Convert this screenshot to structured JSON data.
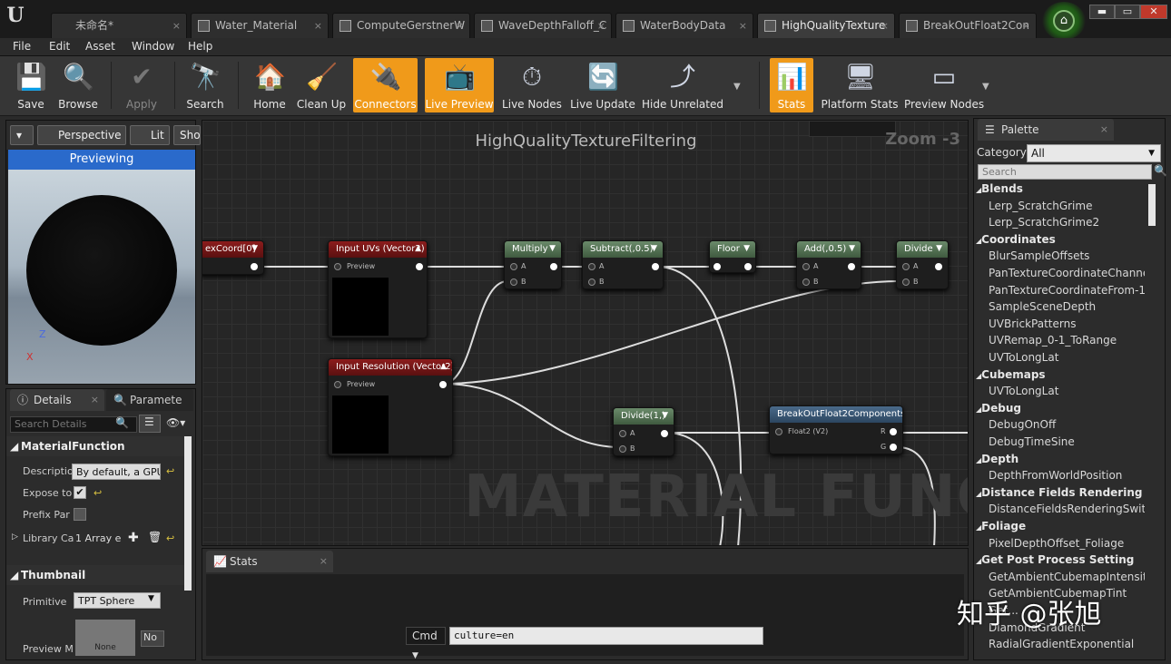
{
  "titlebar": {
    "tabs": [
      {
        "label": "未命名*"
      },
      {
        "label": "Water_Material"
      },
      {
        "label": "ComputeGerstnerW"
      },
      {
        "label": "WaveDepthFalloff_C"
      },
      {
        "label": "WaterBodyData"
      },
      {
        "label": "HighQualityTexture"
      },
      {
        "label": "BreakOutFloat2Con"
      }
    ],
    "close_glyph": "×",
    "window_buttons": {
      "minimize": "▬",
      "maximize": "▭",
      "close": "✕"
    }
  },
  "menu": [
    "File",
    "Edit",
    "Asset",
    "Window",
    "Help"
  ],
  "toolbar": {
    "buttons": [
      {
        "label": "Save",
        "icon": "save-icon"
      },
      {
        "label": "Browse",
        "icon": "browse-icon"
      },
      {
        "label": "Apply",
        "icon": "apply-icon"
      },
      {
        "label": "Search",
        "icon": "search-icon"
      },
      {
        "label": "Home",
        "icon": "home-icon"
      },
      {
        "label": "Clean Up",
        "icon": "cleanup-icon"
      },
      {
        "label": "Connectors",
        "icon": "connectors-icon"
      },
      {
        "label": "Live Preview",
        "icon": "live-preview-icon"
      },
      {
        "label": "Live Nodes",
        "icon": "live-nodes-icon"
      },
      {
        "label": "Live Update",
        "icon": "live-update-icon"
      },
      {
        "label": "Hide Unrelated",
        "icon": "hide-unrelated-icon"
      },
      {
        "label": "Stats",
        "icon": "stats-icon"
      },
      {
        "label": "Platform Stats",
        "icon": "platform-stats-icon"
      },
      {
        "label": "Preview Nodes",
        "icon": "preview-nodes-icon"
      }
    ],
    "active_color": "#f09a1a"
  },
  "viewport": {
    "perspective": "Perspective",
    "lit": "Lit",
    "show": "Sho",
    "previewing": "Previewing",
    "axis_z": "Z",
    "axis_x": "X"
  },
  "details": {
    "tab_details": "Details",
    "tab_parameters": "Paramete",
    "search_placeholder": "Search Details",
    "cat_material_function": "MaterialFunction",
    "description_label": "Descriptio",
    "description_value": "By default, a GPU",
    "expose_label": "Expose to",
    "expose_checked": "✔",
    "prefix_label": "Prefix Par",
    "library_label": "Library Ca",
    "library_value": "1 Array e",
    "cat_thumbnail": "Thumbnail",
    "primitive_label": "Primitive",
    "primitive_value": "TPT Sphere",
    "preview_label": "Preview M",
    "preview_value": "None",
    "preview_dd": "No"
  },
  "graph": {
    "title": "HighQualityTextureFiltering",
    "zoom": "Zoom -3",
    "watermark": "MATERIAL FUNCTION",
    "nodes": {
      "texcoord": "exCoord[0]",
      "input_uvs": "Input UVs (Vector2)",
      "input_res": "Input Resolution (Vector2)",
      "preview": "Preview",
      "multiply": "Multiply",
      "subtract": "Subtract(,0.5)",
      "floor": "Floor",
      "add": "Add(,0.5)",
      "divide": "Divide",
      "divide1": "Divide(1,)",
      "breakout": "BreakOutFloat2Components",
      "float2": "Float2 (V2)",
      "pin_a": "A",
      "pin_b": "B",
      "pin_r": "R",
      "pin_g": "G"
    }
  },
  "stats": {
    "tab": "Stats",
    "cmd": "Cmd",
    "cmd_value": "culture=en"
  },
  "palette": {
    "tab": "Palette",
    "category_label": "Category:",
    "category_value": "All",
    "search_placeholder": "Search",
    "groups": [
      {
        "name": "Blends",
        "items": [
          "Lerp_ScratchGrime",
          "Lerp_ScratchGrime2"
        ]
      },
      {
        "name": "Coordinates",
        "items": [
          "BlurSampleOffsets",
          "PanTextureCoordinateChanne",
          "PanTextureCoordinateFrom-1",
          "SampleSceneDepth",
          "UVBrickPatterns",
          "UVRemap_0-1_ToRange",
          "UVToLongLat"
        ]
      },
      {
        "name": "Cubemaps",
        "items": [
          "UVToLongLat"
        ]
      },
      {
        "name": "Debug",
        "items": [
          "DebugOnOff",
          "DebugTimeSine"
        ]
      },
      {
        "name": "Depth",
        "items": [
          "DepthFromWorldPosition"
        ]
      },
      {
        "name": "Distance Fields Rendering",
        "items": [
          "DistanceFieldsRenderingSwitc"
        ]
      },
      {
        "name": "Foliage",
        "items": [
          "PixelDepthOffset_Foliage"
        ]
      },
      {
        "name": "Get Post Process Setting",
        "items": [
          "GetAmbientCubemapIntensity",
          "GetAmbientCubemapTint",
          "Get...",
          "DiamondGradient",
          "RadialGradientExponential"
        ]
      }
    ]
  },
  "credit": "知乎 @张旭"
}
